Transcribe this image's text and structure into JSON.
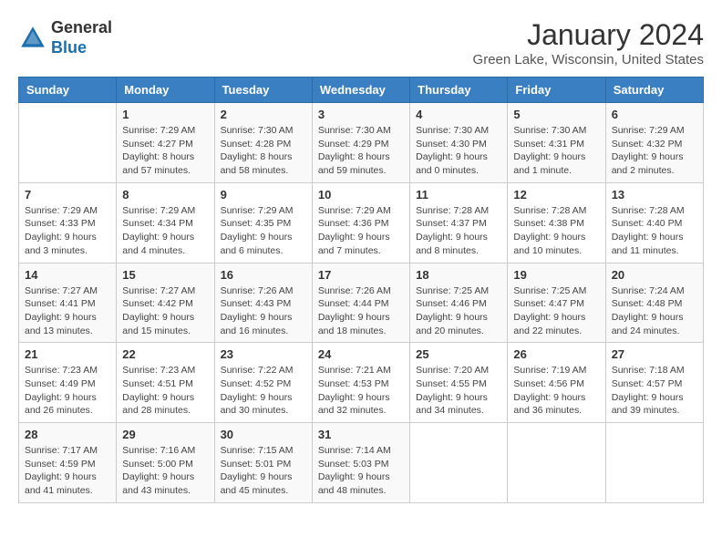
{
  "logo": {
    "general": "General",
    "blue": "Blue"
  },
  "header": {
    "month_year": "January 2024",
    "location": "Green Lake, Wisconsin, United States"
  },
  "weekdays": [
    "Sunday",
    "Monday",
    "Tuesday",
    "Wednesday",
    "Thursday",
    "Friday",
    "Saturday"
  ],
  "weeks": [
    [
      {
        "day": "",
        "info": ""
      },
      {
        "day": "1",
        "info": "Sunrise: 7:29 AM\nSunset: 4:27 PM\nDaylight: 8 hours\nand 57 minutes."
      },
      {
        "day": "2",
        "info": "Sunrise: 7:30 AM\nSunset: 4:28 PM\nDaylight: 8 hours\nand 58 minutes."
      },
      {
        "day": "3",
        "info": "Sunrise: 7:30 AM\nSunset: 4:29 PM\nDaylight: 8 hours\nand 59 minutes."
      },
      {
        "day": "4",
        "info": "Sunrise: 7:30 AM\nSunset: 4:30 PM\nDaylight: 9 hours\nand 0 minutes."
      },
      {
        "day": "5",
        "info": "Sunrise: 7:30 AM\nSunset: 4:31 PM\nDaylight: 9 hours\nand 1 minute."
      },
      {
        "day": "6",
        "info": "Sunrise: 7:29 AM\nSunset: 4:32 PM\nDaylight: 9 hours\nand 2 minutes."
      }
    ],
    [
      {
        "day": "7",
        "info": "Sunrise: 7:29 AM\nSunset: 4:33 PM\nDaylight: 9 hours\nand 3 minutes."
      },
      {
        "day": "8",
        "info": "Sunrise: 7:29 AM\nSunset: 4:34 PM\nDaylight: 9 hours\nand 4 minutes."
      },
      {
        "day": "9",
        "info": "Sunrise: 7:29 AM\nSunset: 4:35 PM\nDaylight: 9 hours\nand 6 minutes."
      },
      {
        "day": "10",
        "info": "Sunrise: 7:29 AM\nSunset: 4:36 PM\nDaylight: 9 hours\nand 7 minutes."
      },
      {
        "day": "11",
        "info": "Sunrise: 7:28 AM\nSunset: 4:37 PM\nDaylight: 9 hours\nand 8 minutes."
      },
      {
        "day": "12",
        "info": "Sunrise: 7:28 AM\nSunset: 4:38 PM\nDaylight: 9 hours\nand 10 minutes."
      },
      {
        "day": "13",
        "info": "Sunrise: 7:28 AM\nSunset: 4:40 PM\nDaylight: 9 hours\nand 11 minutes."
      }
    ],
    [
      {
        "day": "14",
        "info": "Sunrise: 7:27 AM\nSunset: 4:41 PM\nDaylight: 9 hours\nand 13 minutes."
      },
      {
        "day": "15",
        "info": "Sunrise: 7:27 AM\nSunset: 4:42 PM\nDaylight: 9 hours\nand 15 minutes."
      },
      {
        "day": "16",
        "info": "Sunrise: 7:26 AM\nSunset: 4:43 PM\nDaylight: 9 hours\nand 16 minutes."
      },
      {
        "day": "17",
        "info": "Sunrise: 7:26 AM\nSunset: 4:44 PM\nDaylight: 9 hours\nand 18 minutes."
      },
      {
        "day": "18",
        "info": "Sunrise: 7:25 AM\nSunset: 4:46 PM\nDaylight: 9 hours\nand 20 minutes."
      },
      {
        "day": "19",
        "info": "Sunrise: 7:25 AM\nSunset: 4:47 PM\nDaylight: 9 hours\nand 22 minutes."
      },
      {
        "day": "20",
        "info": "Sunrise: 7:24 AM\nSunset: 4:48 PM\nDaylight: 9 hours\nand 24 minutes."
      }
    ],
    [
      {
        "day": "21",
        "info": "Sunrise: 7:23 AM\nSunset: 4:49 PM\nDaylight: 9 hours\nand 26 minutes."
      },
      {
        "day": "22",
        "info": "Sunrise: 7:23 AM\nSunset: 4:51 PM\nDaylight: 9 hours\nand 28 minutes."
      },
      {
        "day": "23",
        "info": "Sunrise: 7:22 AM\nSunset: 4:52 PM\nDaylight: 9 hours\nand 30 minutes."
      },
      {
        "day": "24",
        "info": "Sunrise: 7:21 AM\nSunset: 4:53 PM\nDaylight: 9 hours\nand 32 minutes."
      },
      {
        "day": "25",
        "info": "Sunrise: 7:20 AM\nSunset: 4:55 PM\nDaylight: 9 hours\nand 34 minutes."
      },
      {
        "day": "26",
        "info": "Sunrise: 7:19 AM\nSunset: 4:56 PM\nDaylight: 9 hours\nand 36 minutes."
      },
      {
        "day": "27",
        "info": "Sunrise: 7:18 AM\nSunset: 4:57 PM\nDaylight: 9 hours\nand 39 minutes."
      }
    ],
    [
      {
        "day": "28",
        "info": "Sunrise: 7:17 AM\nSunset: 4:59 PM\nDaylight: 9 hours\nand 41 minutes."
      },
      {
        "day": "29",
        "info": "Sunrise: 7:16 AM\nSunset: 5:00 PM\nDaylight: 9 hours\nand 43 minutes."
      },
      {
        "day": "30",
        "info": "Sunrise: 7:15 AM\nSunset: 5:01 PM\nDaylight: 9 hours\nand 45 minutes."
      },
      {
        "day": "31",
        "info": "Sunrise: 7:14 AM\nSunset: 5:03 PM\nDaylight: 9 hours\nand 48 minutes."
      },
      {
        "day": "",
        "info": ""
      },
      {
        "day": "",
        "info": ""
      },
      {
        "day": "",
        "info": ""
      }
    ]
  ]
}
